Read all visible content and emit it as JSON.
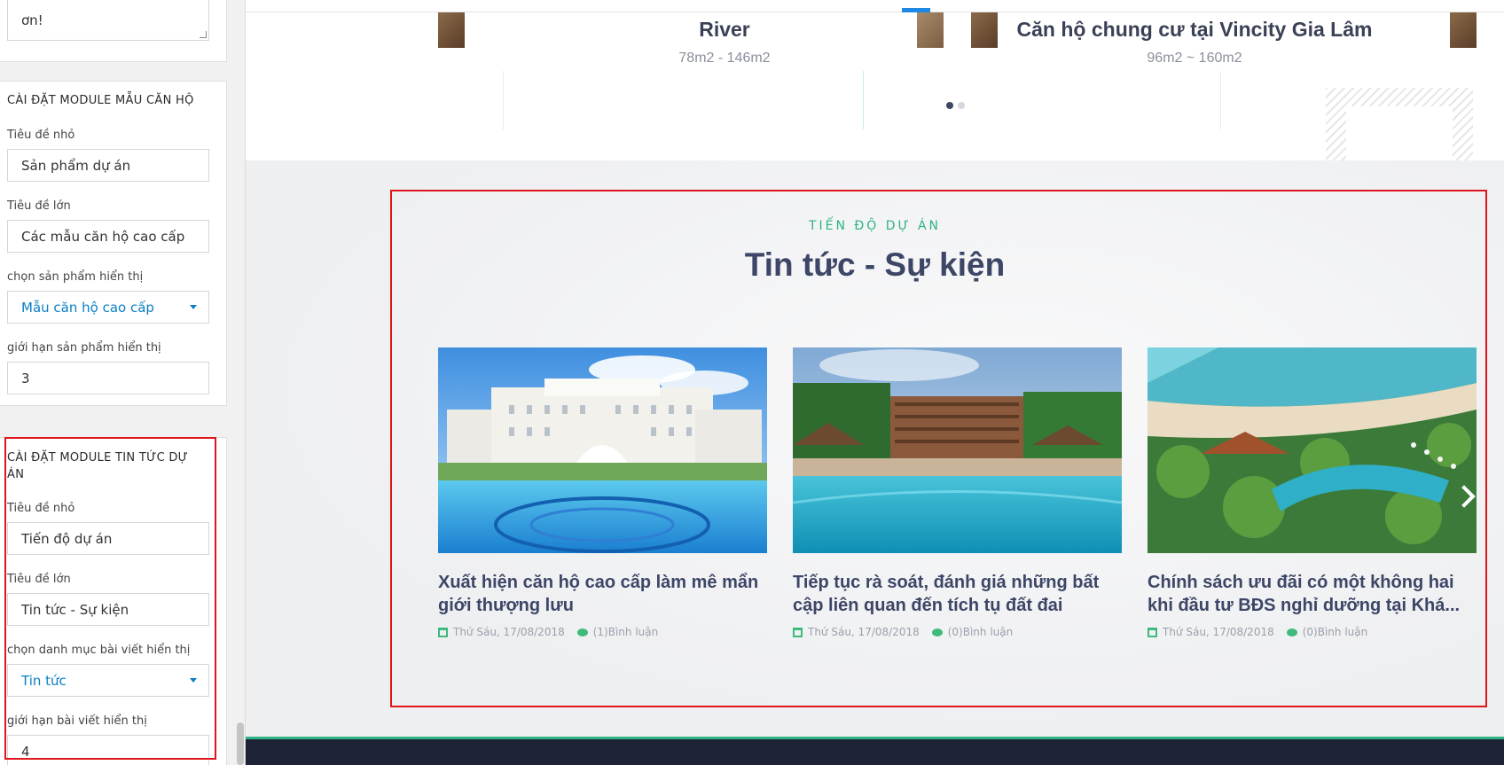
{
  "sidebar": {
    "top_textarea": {
      "value": "ơn!"
    },
    "module_apartments": {
      "title": "CÀI ĐẶT MODULE MẪU CĂN HỘ",
      "small_title_label": "Tiêu đề nhỏ",
      "small_title_value": "Sản phẩm dự án",
      "big_title_label": "Tiêu đề lớn",
      "big_title_value": "Các mẫu căn hộ cao cấp",
      "select_label": "chọn sản phẩm hiển thị",
      "select_value": "Mẫu căn hộ cao cấp",
      "limit_label": "giới hạn sản phẩm hiển thị",
      "limit_value": "3"
    },
    "module_news": {
      "title": "CÀI ĐẶT MODULE TIN TỨC DỰ ÁN",
      "small_title_label": "Tiêu đề nhỏ",
      "small_title_value": "Tiến độ dự án",
      "big_title_label": "Tiêu đề lớn",
      "big_title_value": "Tin tức - Sự kiện",
      "select_label": "chọn danh mục bài viết hiển thị",
      "select_value": "Tin tức",
      "limit_label": "giới hạn bài viết hiển thị",
      "limit_value": "4"
    }
  },
  "preview": {
    "projects": [
      {
        "title": "River",
        "size": "78m2 - 146m2"
      },
      {
        "title": "Căn hộ chung cư tại Vincity Gia Lâm",
        "size": "96m2 ~ 160m2"
      }
    ],
    "news": {
      "eyebrow": "TIẾN ĐỘ DỰ ÁN",
      "heading": "Tin tức - Sự kiện",
      "cards": [
        {
          "title": "Xuất hiện căn hộ cao cấp làm mê mẩn giới thượng lưu",
          "date": "Thứ Sáu, 17/08/2018",
          "comments": "(1)Bình luận"
        },
        {
          "title": "Tiếp tục rà soát, đánh giá những bất cập liên quan đến tích tụ đất đai",
          "date": "Thứ Sáu, 17/08/2018",
          "comments": "(0)Bình luận"
        },
        {
          "title": "Chính sách ưu đãi có một không hai khi đầu tư BĐS nghỉ dưỡng tại Khá...",
          "date": "Thứ Sáu, 17/08/2018",
          "comments": "(0)Bình luận"
        }
      ]
    }
  },
  "colors": {
    "accent_green": "#2fb383",
    "heading_navy": "#3d4666",
    "select_blue": "#0a7fc4",
    "highlight_red": "#e0151b"
  }
}
